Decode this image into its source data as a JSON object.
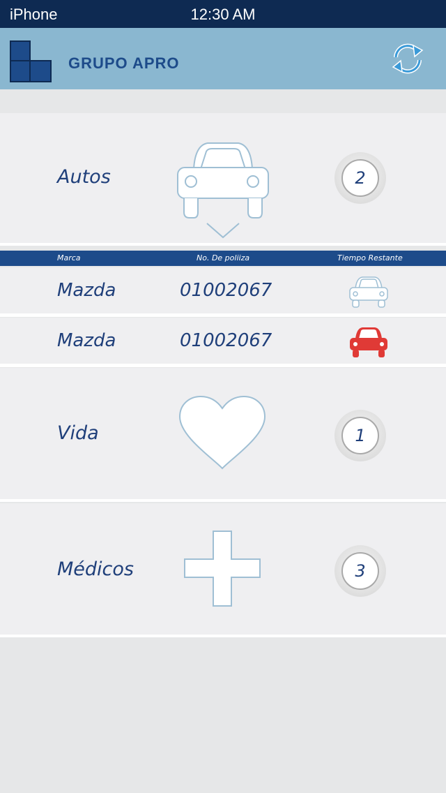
{
  "status_bar": {
    "carrier": "iPhone",
    "time": "12:30 AM"
  },
  "header": {
    "brand": "GRUPO APRO",
    "refresh_icon": "refresh-icon"
  },
  "colors": {
    "navy": "#0e2a52",
    "header": "#8ab7d0",
    "text": "#1f3f7a",
    "alert": "#e03a36"
  },
  "categories": [
    {
      "label": "Autos",
      "icon": "car-icon",
      "count": "2"
    },
    {
      "label": "Vida",
      "icon": "heart-icon",
      "count": "1"
    },
    {
      "label": "Médicos",
      "icon": "cross-icon",
      "count": "3"
    }
  ],
  "policy_table": {
    "columns": [
      "Marca",
      "No. De poliiza",
      "Tiempo Restante"
    ],
    "rows": [
      {
        "marca": "Mazda",
        "poliza": "01002067",
        "status_icon": "car-outline-icon"
      },
      {
        "marca": "Mazda",
        "poliza": "01002067",
        "status_icon": "car-red-icon"
      }
    ]
  }
}
